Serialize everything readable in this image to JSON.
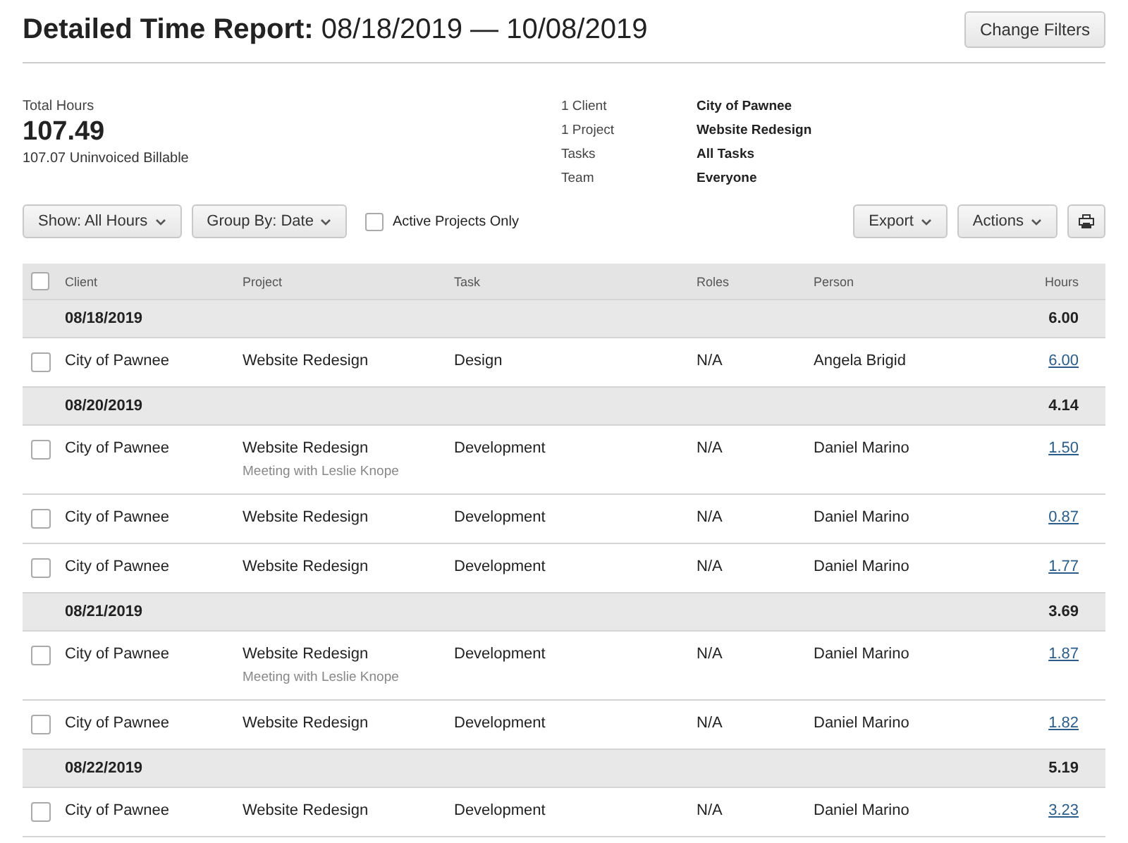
{
  "header": {
    "title_bold": "Detailed Time Report:",
    "date_range": "08/18/2019 — 10/08/2019",
    "button": "Change Filters"
  },
  "summary": {
    "label": "Total Hours",
    "total": "107.49",
    "subtext": "107.07 Uninvoiced Billable",
    "filters": [
      {
        "label": "1 Client",
        "value": "City of Pawnee"
      },
      {
        "label": "1 Project",
        "value": "Website Redesign"
      },
      {
        "label": "Tasks",
        "value": "All Tasks"
      },
      {
        "label": "Team",
        "value": "Everyone"
      }
    ]
  },
  "toolbar": {
    "show": "Show: All Hours",
    "group_by": "Group By: Date",
    "active_only": {
      "label": "Active Projects Only",
      "checked": false
    },
    "export": "Export",
    "actions": "Actions"
  },
  "table": {
    "columns": [
      "Client",
      "Project",
      "Task",
      "Roles",
      "Person",
      "Hours"
    ],
    "select_all_checked": false,
    "groups": [
      {
        "date": "08/18/2019",
        "total": "6.00",
        "entries": [
          {
            "client": "City of Pawnee",
            "project": "Website Redesign",
            "task": "Design",
            "roles": "N/A",
            "person": "Angela Brigid",
            "hours": "6.00",
            "checked": false
          }
        ]
      },
      {
        "date": "08/20/2019",
        "total": "4.14",
        "entries": [
          {
            "client": "City of Pawnee",
            "project": "Website Redesign",
            "note": "Meeting with Leslie Knope",
            "task": "Development",
            "roles": "N/A",
            "person": "Daniel Marino",
            "hours": "1.50",
            "checked": false
          },
          {
            "client": "City of Pawnee",
            "project": "Website Redesign",
            "task": "Development",
            "roles": "N/A",
            "person": "Daniel Marino",
            "hours": "0.87",
            "checked": false
          },
          {
            "client": "City of Pawnee",
            "project": "Website Redesign",
            "task": "Development",
            "roles": "N/A",
            "person": "Daniel Marino",
            "hours": "1.77",
            "checked": false
          }
        ]
      },
      {
        "date": "08/21/2019",
        "total": "3.69",
        "entries": [
          {
            "client": "City of Pawnee",
            "project": "Website Redesign",
            "note": "Meeting with Leslie Knope",
            "task": "Development",
            "roles": "N/A",
            "person": "Daniel Marino",
            "hours": "1.87",
            "checked": false
          },
          {
            "client": "City of Pawnee",
            "project": "Website Redesign",
            "task": "Development",
            "roles": "N/A",
            "person": "Daniel Marino",
            "hours": "1.82",
            "checked": false
          }
        ]
      },
      {
        "date": "08/22/2019",
        "total": "5.19",
        "entries": [
          {
            "client": "City of Pawnee",
            "project": "Website Redesign",
            "task": "Development",
            "roles": "N/A",
            "person": "Daniel Marino",
            "hours": "3.23",
            "checked": false
          }
        ]
      }
    ]
  }
}
